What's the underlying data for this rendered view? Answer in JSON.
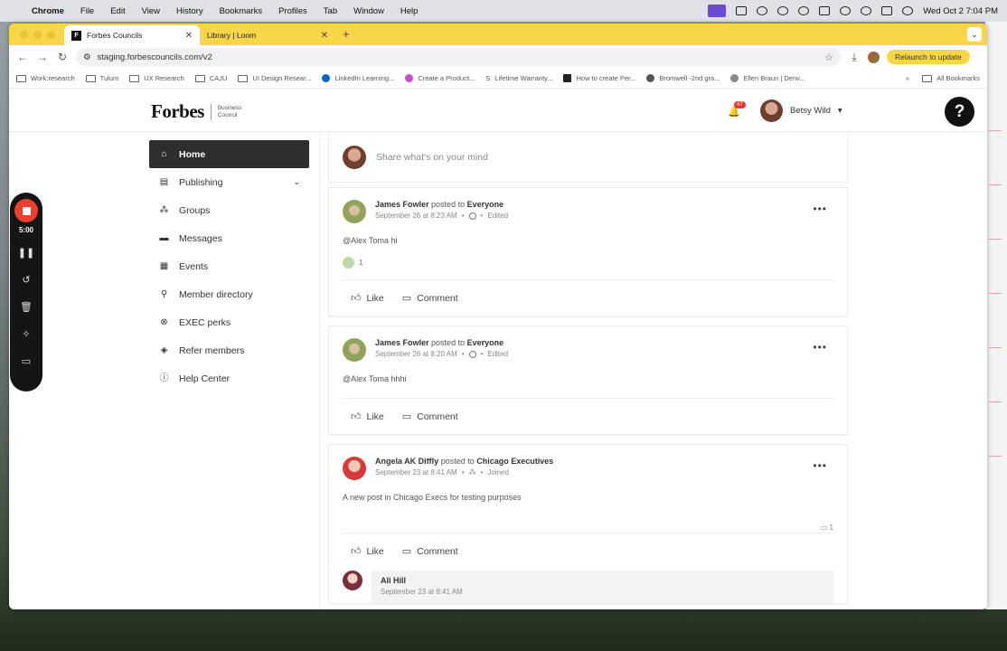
{
  "menubar": {
    "app": "Chrome",
    "items": [
      "File",
      "Edit",
      "View",
      "History",
      "Bookmarks",
      "Profiles",
      "Tab",
      "Window",
      "Help"
    ],
    "datetime": "Wed Oct 2  7:04 PM"
  },
  "browser": {
    "tabs": [
      {
        "title": "Forbes Councils",
        "icon": "F"
      },
      {
        "title": "Library | Loom",
        "icon": "✱"
      }
    ],
    "url": "staging.forbescouncils.com/v2",
    "relaunch_label": "Relaunch to update",
    "bookmarks": [
      "Work:research",
      "Tulum",
      "UX Research",
      "CAJU",
      "UI Design Resear...",
      "LinkedIn Learning...",
      "Create a Product...",
      "Lifetime Warranty...",
      "How to create Per...",
      "Bromwell -2nd gra...",
      "Ellen Braun | Denv..."
    ],
    "all_bookmarks": "All Bookmarks"
  },
  "header": {
    "logo_text": "Forbes",
    "logo_sub_line1": "Business",
    "logo_sub_line2": "Council",
    "notification_count": "47",
    "user_name": "Betsy Wild",
    "help_label": "?"
  },
  "sidebar": {
    "items": [
      {
        "label": "Home",
        "icon": "home-icon"
      },
      {
        "label": "Publishing",
        "icon": "document-icon"
      },
      {
        "label": "Groups",
        "icon": "groups-icon"
      },
      {
        "label": "Messages",
        "icon": "message-icon"
      },
      {
        "label": "Events",
        "icon": "calendar-icon"
      },
      {
        "label": "Member directory",
        "icon": "person-search-icon"
      },
      {
        "label": "EXEC perks",
        "icon": "perks-icon"
      },
      {
        "label": "Refer members",
        "icon": "refer-icon"
      },
      {
        "label": "Help Center",
        "icon": "help-circle-icon"
      }
    ]
  },
  "composer": {
    "placeholder": "Share what's on your mind"
  },
  "posts": [
    {
      "author": "James Fowler",
      "posted_to_text": "posted to",
      "audience": "Everyone",
      "time": "September 26 at 8:23 AM",
      "status": "Edited",
      "body": "@Alex Toma hi",
      "reactions": "1"
    },
    {
      "author": "James Fowler",
      "posted_to_text": "posted to",
      "audience": "Everyone",
      "time": "September 26 at 8:20 AM",
      "status": "Edited",
      "body": "@Alex Toma hhhi"
    },
    {
      "author": "Angela AK Diffly",
      "posted_to_text": "posted to",
      "audience": "Chicago Executives",
      "time": "September 23 at 8:41 AM",
      "status": "Joined",
      "body": "A new post in Chicago Execs for testing purposes",
      "comments": "1",
      "comment": {
        "author": "Ali Hill",
        "time": "September 23 at 8:41 AM"
      }
    }
  ],
  "actions": {
    "like": "Like",
    "comment": "Comment"
  },
  "loom": {
    "timer": "5:00"
  }
}
